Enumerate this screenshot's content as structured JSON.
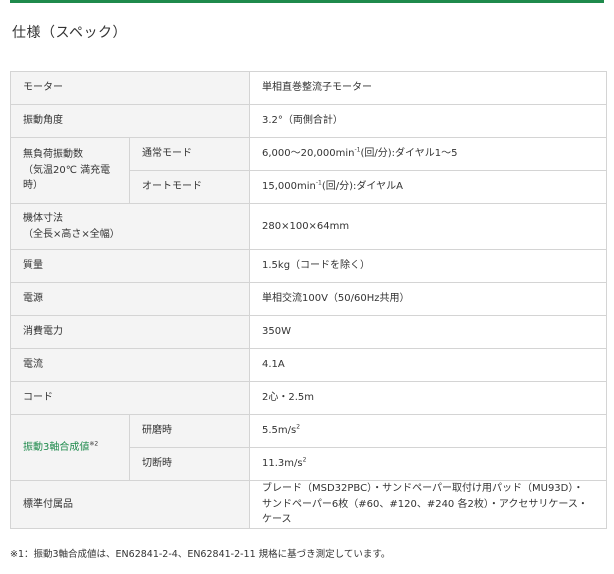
{
  "title": "仕様（スペック）",
  "colors": {
    "accent": "#1f8a4c",
    "label_bg": "#f4f4f4",
    "border": "#d4d4d4"
  },
  "rows": {
    "motor": {
      "label": "モーター",
      "value": "単相直巻整流子モーター"
    },
    "angle": {
      "label": "振動角度",
      "value": "3.2°（両側合計）"
    },
    "vib": {
      "label_1": "無負荷振動数",
      "label_2": "（気温20℃ 満充電時）",
      "normal_label": "通常モード",
      "normal_pre": "6,000～20,000min",
      "normal_sup": "-1",
      "normal_post": "(回/分):ダイヤル1～5",
      "auto_label": "オートモード",
      "auto_pre": "15,000min",
      "auto_sup": "-1",
      "auto_post": "(回/分):ダイヤルA"
    },
    "dims": {
      "label_1": "機体寸法",
      "label_2": "（全長×高さ×全幅）",
      "value": "280×100×64mm"
    },
    "mass": {
      "label": "質量",
      "value": "1.5kg（コードを除く）"
    },
    "power": {
      "label": "電源",
      "value": "単相交流100V（50/60Hz共用）"
    },
    "consumption": {
      "label": "消費電力",
      "value": "350W"
    },
    "current": {
      "label": "電流",
      "value": "4.1A"
    },
    "cord": {
      "label": "コード",
      "value": "2心・2.5m"
    },
    "tri": {
      "label": "振動3軸合成値",
      "label_sup": "※2",
      "grind_label": "研磨時",
      "grind_value": "5.5m/s",
      "grind_sup": "2",
      "cut_label": "切断時",
      "cut_value": "11.3m/s",
      "cut_sup": "2"
    },
    "accessories": {
      "label": "標準付属品",
      "line_1": "ブレード（MSD32PBC）・サンドペーパー取付け用パッド（MU93D）・",
      "line_2": "サンドペーパー6枚（#60、#120、#240 各2枚）・アクセサリケース・ケース"
    }
  },
  "footnote": "※1：振動3軸合成値は、EN62841-2-4、EN62841-2-11 規格に基づき測定しています。"
}
